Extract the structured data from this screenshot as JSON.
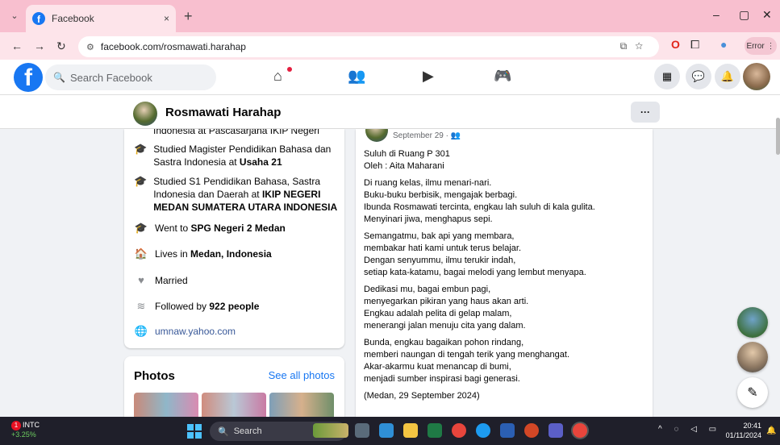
{
  "browser": {
    "tab_title": "Facebook",
    "tab_close": "×",
    "new_tab": "+",
    "url": "facebook.com/rosmawati.harahap",
    "error_label": "Error",
    "window_controls": [
      "–",
      "▢",
      "✕"
    ]
  },
  "facebook": {
    "search_placeholder": "Search Facebook",
    "logo_letter": "f"
  },
  "profile": {
    "name": "Rosmawati Harahap",
    "more": "···"
  },
  "intro": {
    "cut_line": "Indonesia at Pascasarjana IKIP Negeri",
    "items": [
      {
        "icon": "graduation-cap-icon",
        "prefix": "Studied Magister Pendidikan Bahasa dan Sastra Indonesia at ",
        "bold": "Usaha 21"
      },
      {
        "icon": "graduation-cap-icon",
        "prefix": "Studied S1 Pendidikan Bahasa, Sastra Indonesia dan Daerah at ",
        "bold": "IKIP NEGERI MEDAN SUMATERA UTARA INDONESIA"
      },
      {
        "icon": "graduation-cap-icon",
        "prefix": "Went to ",
        "bold": "SPG Negeri 2 Medan"
      },
      {
        "icon": "home-icon",
        "prefix": "Lives in ",
        "bold": "Medan, Indonesia"
      },
      {
        "icon": "heart-icon",
        "prefix": "Married",
        "bold": ""
      },
      {
        "icon": "rss-icon",
        "prefix": "Followed by ",
        "bold": "922 people"
      },
      {
        "icon": "globe-icon",
        "link": "umnaw.yahoo.com"
      }
    ]
  },
  "photos": {
    "title": "Photos",
    "see_all": "See all photos"
  },
  "post": {
    "date": "September 29 · 👥",
    "stanzas": [
      [
        "Suluh di Ruang  P 301",
        "Oleh : Aita Maharani"
      ],
      [
        "Di ruang kelas, ilmu menari-nari.",
        "Buku-buku berbisik, mengajak berbagi.",
        "Ibunda Rosmawati tercinta, engkau lah suluh di kala gulita.",
        "Menyinari jiwa, menghapus sepi."
      ],
      [
        "Semangatmu, bak api yang membara,",
        "membakar hati kami untuk terus belajar.",
        "Dengan senyummu, ilmu terukir indah,",
        "setiap kata-katamu, bagai melodi yang lembut menyapa."
      ],
      [
        "Dedikasi mu, bagai embun pagi,",
        "menyegarkan pikiran yang haus akan arti.",
        "Engkau adalah pelita di gelap malam,",
        "menerangi jalan menuju cita yang dalam."
      ],
      [
        "Bunda, engkau bagaikan pohon rindang,",
        "memberi naungan di tengah terik yang menghangat.",
        "Akar-akarmu kuat menancap di bumi,",
        "menjadi sumber inspirasi bagi generasi."
      ],
      [
        "(Medan, 29 September 2024)"
      ]
    ]
  },
  "taskbar": {
    "stock_name": "INTC",
    "stock_change": "+3.25%",
    "stock_badge": "1",
    "search_placeholder": "Search",
    "time": "20:41",
    "date": "01/11/2024"
  }
}
